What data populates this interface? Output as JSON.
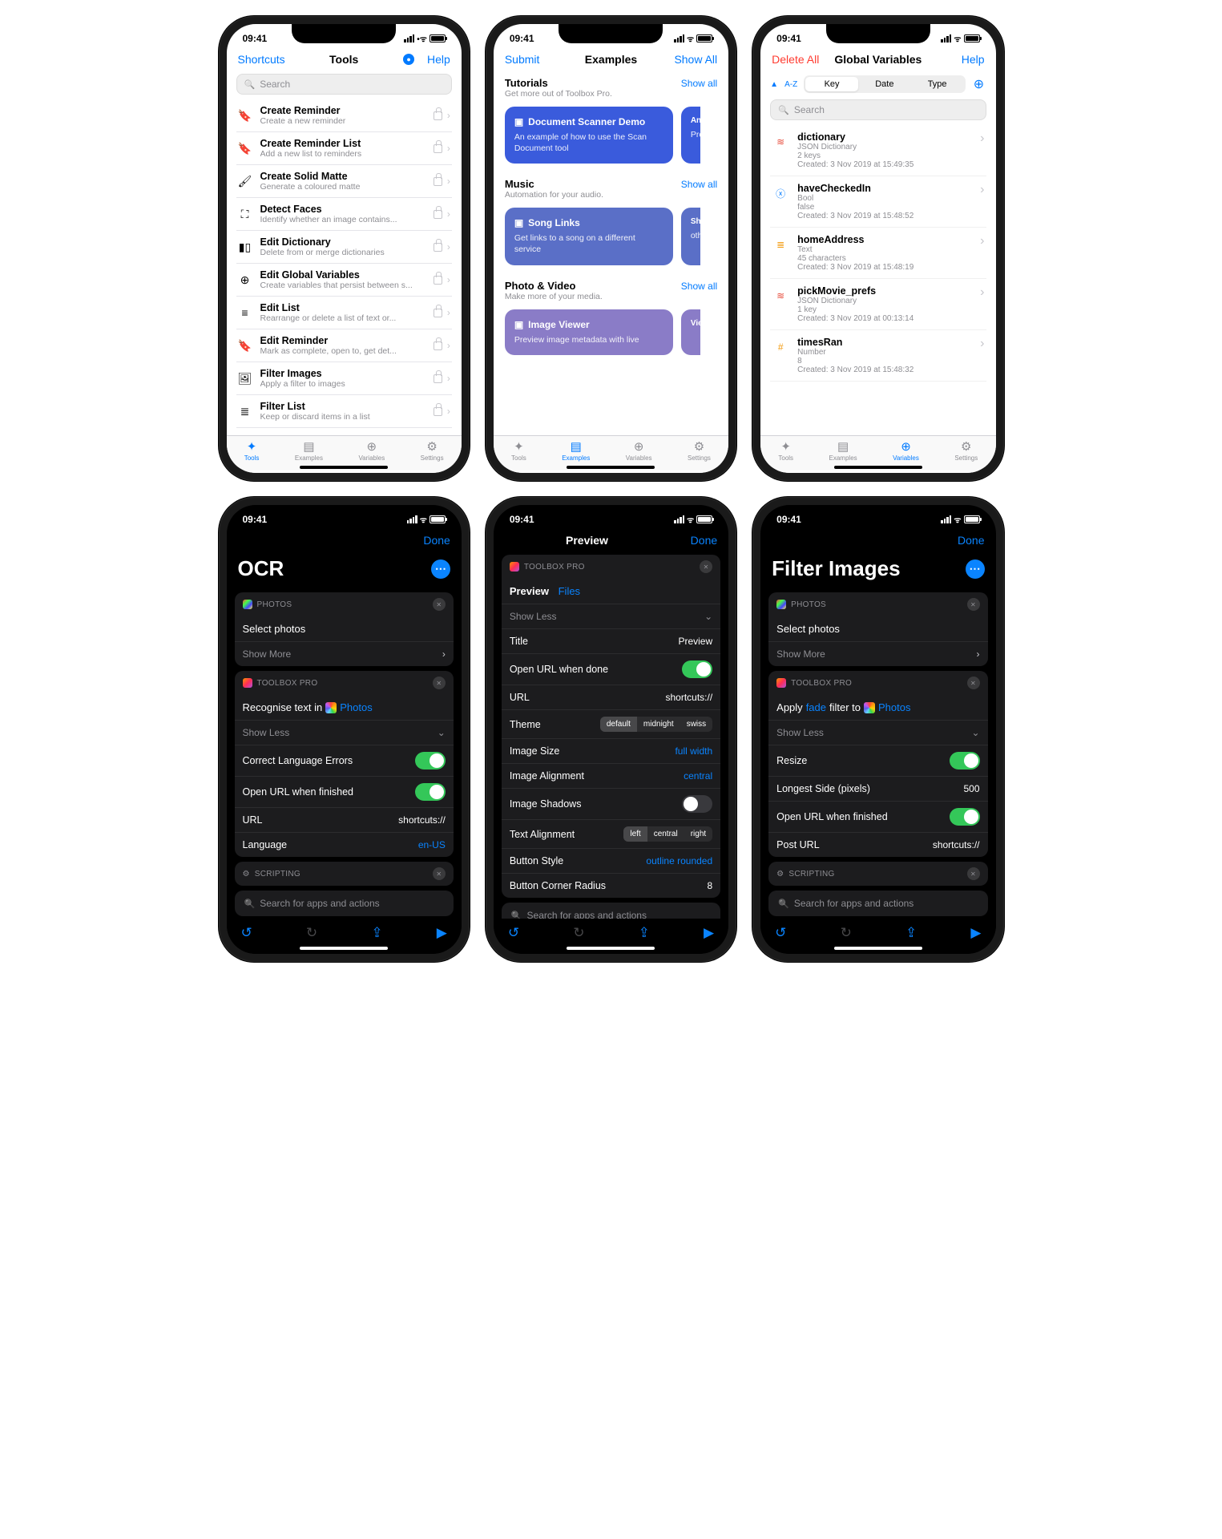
{
  "time": "09:41",
  "phone1": {
    "nav_left": "Shortcuts",
    "title": "Tools",
    "nav_right": "Help",
    "search_ph": "Search",
    "rows": [
      {
        "t": "Create Reminder",
        "s": "Create a new reminder"
      },
      {
        "t": "Create Reminder List",
        "s": "Add a new list to reminders"
      },
      {
        "t": "Create Solid Matte",
        "s": "Generate a coloured matte"
      },
      {
        "t": "Detect Faces",
        "s": "Identify whether an image contains..."
      },
      {
        "t": "Edit Dictionary",
        "s": "Delete from or merge dictionaries"
      },
      {
        "t": "Edit Global Variables",
        "s": "Create variables that persist between s..."
      },
      {
        "t": "Edit List",
        "s": "Rearrange or delete a list of text or..."
      },
      {
        "t": "Edit Reminder",
        "s": "Mark as complete, open to, get det..."
      },
      {
        "t": "Filter Images",
        "s": "Apply a filter to images"
      },
      {
        "t": "Filter List",
        "s": "Keep or discard items in a list"
      }
    ],
    "tabs": {
      "tools": "Tools",
      "ex": "Examples",
      "vars": "Variables",
      "set": "Settings"
    }
  },
  "phone2": {
    "nav_left": "Submit",
    "title": "Examples",
    "nav_right": "Show All",
    "sections": [
      {
        "t": "Tutorials",
        "s": "Get more out of Toolbox Pro.",
        "all": "Show all",
        "card_t": "Document Scanner Demo",
        "card_d": "An example of how to use the Scan Document tool",
        "c2a": "An",
        "c2b": "Pre"
      },
      {
        "t": "Music",
        "s": "Automation for your audio.",
        "all": "Show all",
        "card_t": "Song Links",
        "card_d": "Get links to a song on a different service",
        "c2a": "Sh",
        "c2b": "oth"
      },
      {
        "t": "Photo & Video",
        "s": "Make more of your media.",
        "all": "Show all",
        "card_t": "Image Viewer",
        "card_d": "Preview image metadata with live",
        "c2a": "Vie",
        "c2b": ""
      }
    ]
  },
  "phone3": {
    "nav_left": "Delete All",
    "title": "Global Variables",
    "nav_right": "Help",
    "az": "A-Z",
    "seg": [
      "Key",
      "Date",
      "Type"
    ],
    "search_ph": "Search",
    "vars": [
      {
        "n": "dictionary",
        "t": "JSON Dictionary",
        "d": "2 keys",
        "c": "Created: 3 Nov 2019 at 15:49:35",
        "ico": "stack"
      },
      {
        "n": "haveCheckedIn",
        "t": "Bool",
        "d": "false",
        "c": "Created: 3 Nov 2019 at 15:48:52",
        "ico": "bool"
      },
      {
        "n": "homeAddress",
        "t": "Text",
        "d": "45 characters",
        "c": "Created: 3 Nov 2019 at 15:48:19",
        "ico": "text"
      },
      {
        "n": "pickMovie_prefs",
        "t": "JSON Dictionary",
        "d": "1 key",
        "c": "Created: 3 Nov 2019 at 00:13:14",
        "ico": "stack"
      },
      {
        "n": "timesRan",
        "t": "Number",
        "d": "8",
        "c": "Created: 3 Nov 2019 at 15:48:32",
        "ico": "num"
      }
    ]
  },
  "phone4": {
    "done": "Done",
    "title": "OCR",
    "photos_lbl": "PHOTOS",
    "sel": "Select photos",
    "more": "Show More",
    "tbp": "TOOLBOX PRO",
    "rec_a": "Recognise text in",
    "rec_b": "Photos",
    "less": "Show Less",
    "r1": "Correct Language Errors",
    "r2": "Open URL when finished",
    "r3": "URL",
    "r3v": "shortcuts://",
    "r4": "Language",
    "r4v": "en-US",
    "scr": "SCRIPTING",
    "srch": "Search for apps and actions"
  },
  "phone5": {
    "title": "Preview",
    "done": "Done",
    "tbp": "TOOLBOX PRO",
    "hdr_a": "Preview",
    "hdr_b": "Files",
    "less": "Show Less",
    "rows": {
      "title_l": "Title",
      "title_v": "Preview",
      "ourl": "Open URL when done",
      "url_l": "URL",
      "url_v": "shortcuts://",
      "theme_l": "Theme",
      "theme_opts": [
        "default",
        "midnight",
        "swiss"
      ],
      "isize_l": "Image Size",
      "isize_v": "full width",
      "ialign_l": "Image Alignment",
      "ialign_v": "central",
      "ishad_l": "Image Shadows",
      "talign_l": "Text Alignment",
      "talign_opts": [
        "left",
        "central",
        "right"
      ],
      "bstyle_l": "Button Style",
      "bstyle_v": "outline rounded",
      "brad_l": "Button Corner Radius",
      "brad_v": "8"
    },
    "srch": "Search for apps and actions"
  },
  "phone6": {
    "done": "Done",
    "title": "Filter Images",
    "photos_lbl": "PHOTOS",
    "sel": "Select photos",
    "more": "Show More",
    "tbp": "TOOLBOX PRO",
    "ap_a": "Apply",
    "ap_b": "fade",
    "ap_c": "filter to",
    "ap_d": "Photos",
    "less": "Show Less",
    "r1": "Resize",
    "r2": "Longest Side (pixels)",
    "r2v": "500",
    "r3": "Open URL when finished",
    "r4": "Post URL",
    "r4v": "shortcuts://",
    "scr": "SCRIPTING",
    "srch": "Search for apps and actions"
  }
}
